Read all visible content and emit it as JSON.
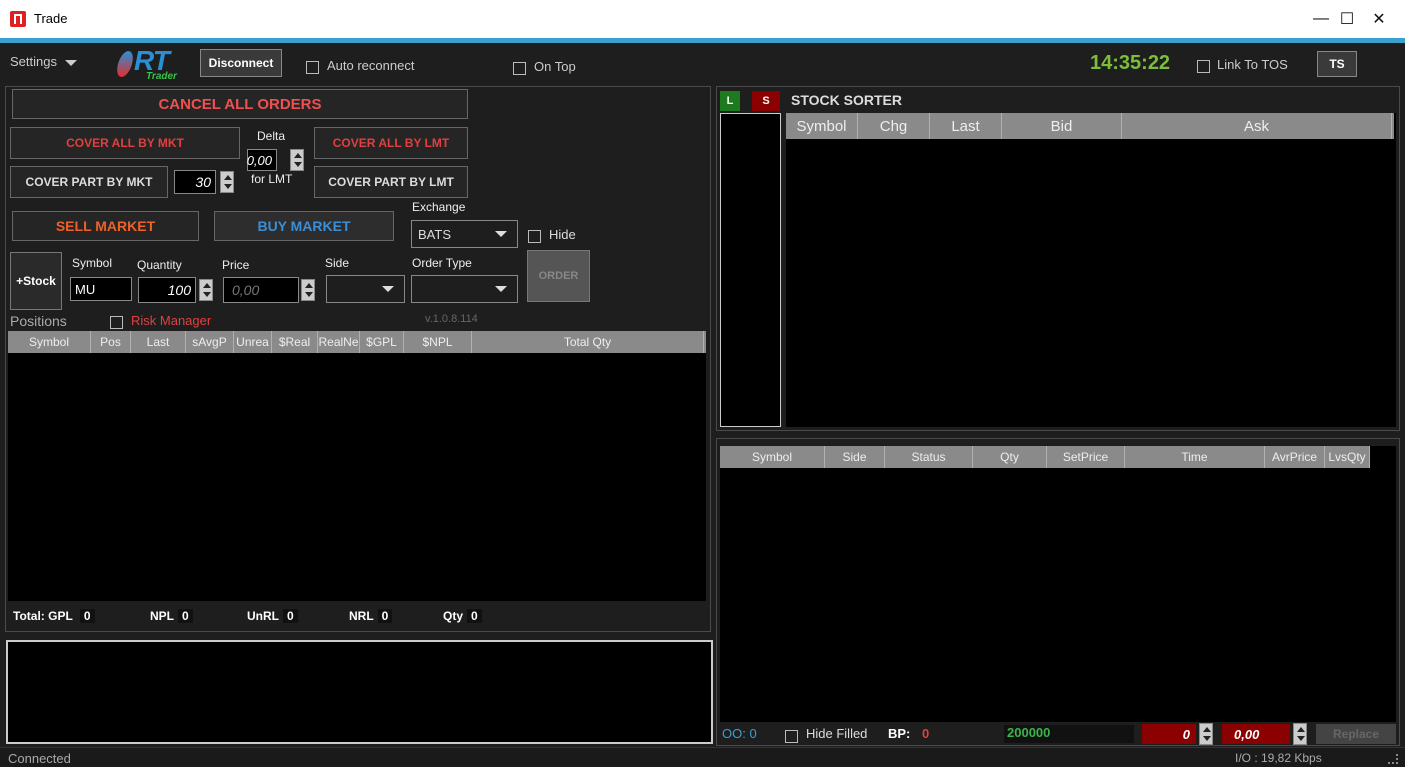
{
  "window": {
    "title": "Trade",
    "minimize": "—",
    "maximize": "☐",
    "close": "✕"
  },
  "toolbar": {
    "settings": "Settings",
    "logo_text": "RT",
    "logo_sub": "Trader",
    "disconnect": "Disconnect",
    "auto_reconnect": "Auto reconnect",
    "on_top": "On Top",
    "clock": "14:35:22",
    "link_tos": "Link To TOS",
    "ts": "TS"
  },
  "orders": {
    "cancel_all": "CANCEL ALL ORDERS",
    "cover_all_mkt": "COVER ALL BY MKT",
    "cover_all_lmt": "COVER ALL BY LMT",
    "delta_label": "Delta",
    "delta_value": "0,00",
    "for_lmt": "for LMT",
    "cover_part_mkt": "COVER PART BY MKT",
    "cover_part_qty": "30",
    "cover_part_lmt": "COVER PART BY LMT",
    "sell_market": "SELL MARKET",
    "buy_market": "BUY MARKET",
    "exchange_label": "Exchange",
    "exchange_value": "BATS",
    "hide": "Hide",
    "add_stock": "+Stock",
    "symbol_label": "Symbol",
    "symbol_value": "MU",
    "quantity_label": "Quantity",
    "quantity_value": "100",
    "price_label": "Price",
    "price_value": "0,00",
    "side_label": "Side",
    "order_type_label": "Order Type",
    "order_button": "ORDER"
  },
  "positions": {
    "label": "Positions",
    "risk_manager": "Risk Manager",
    "version": "v.1.0.8.114",
    "columns": [
      "Symbol",
      "Pos",
      "Last",
      "sAvgP",
      "Unrea",
      "$Real",
      "RealNe",
      "$GPL",
      "$NPL",
      "Total Qty"
    ]
  },
  "totals": {
    "total_label": "Total:",
    "gpl_label": "GPL",
    "gpl": "0",
    "npl_label": "NPL",
    "npl": "0",
    "unrl_label": "UnRL",
    "unrl": "0",
    "nrl_label": "NRL",
    "nrl": "0",
    "qty_label": "Qty",
    "qty": "0"
  },
  "sorter": {
    "long": "L",
    "short": "S",
    "title": "STOCK SORTER",
    "columns": [
      "Symbol",
      "Chg",
      "Last",
      "Bid",
      "Ask"
    ]
  },
  "order_grid": {
    "columns": [
      "Symbol",
      "Side",
      "Status",
      "Qty",
      "SetPrice",
      "Time",
      "AvrPrice",
      "LvsQty"
    ]
  },
  "bottom_bar": {
    "oo_label": "OO:",
    "oo_value": "0",
    "hide_filled": "Hide Filled",
    "bp_label": "BP:",
    "bp_value": "0",
    "bp_amount": "200000",
    "qty_value": "0",
    "price_value": "0,00",
    "replace": "Replace"
  },
  "status": {
    "text": "Connected",
    "io": "I/O : 19,82 Kbps"
  },
  "colors": {
    "accent": "#3aa0d0",
    "red_text": "#e04040",
    "blue_text": "#3b8fd6",
    "orange_text": "#f0602a",
    "green_clock": "#7cbf3a"
  }
}
